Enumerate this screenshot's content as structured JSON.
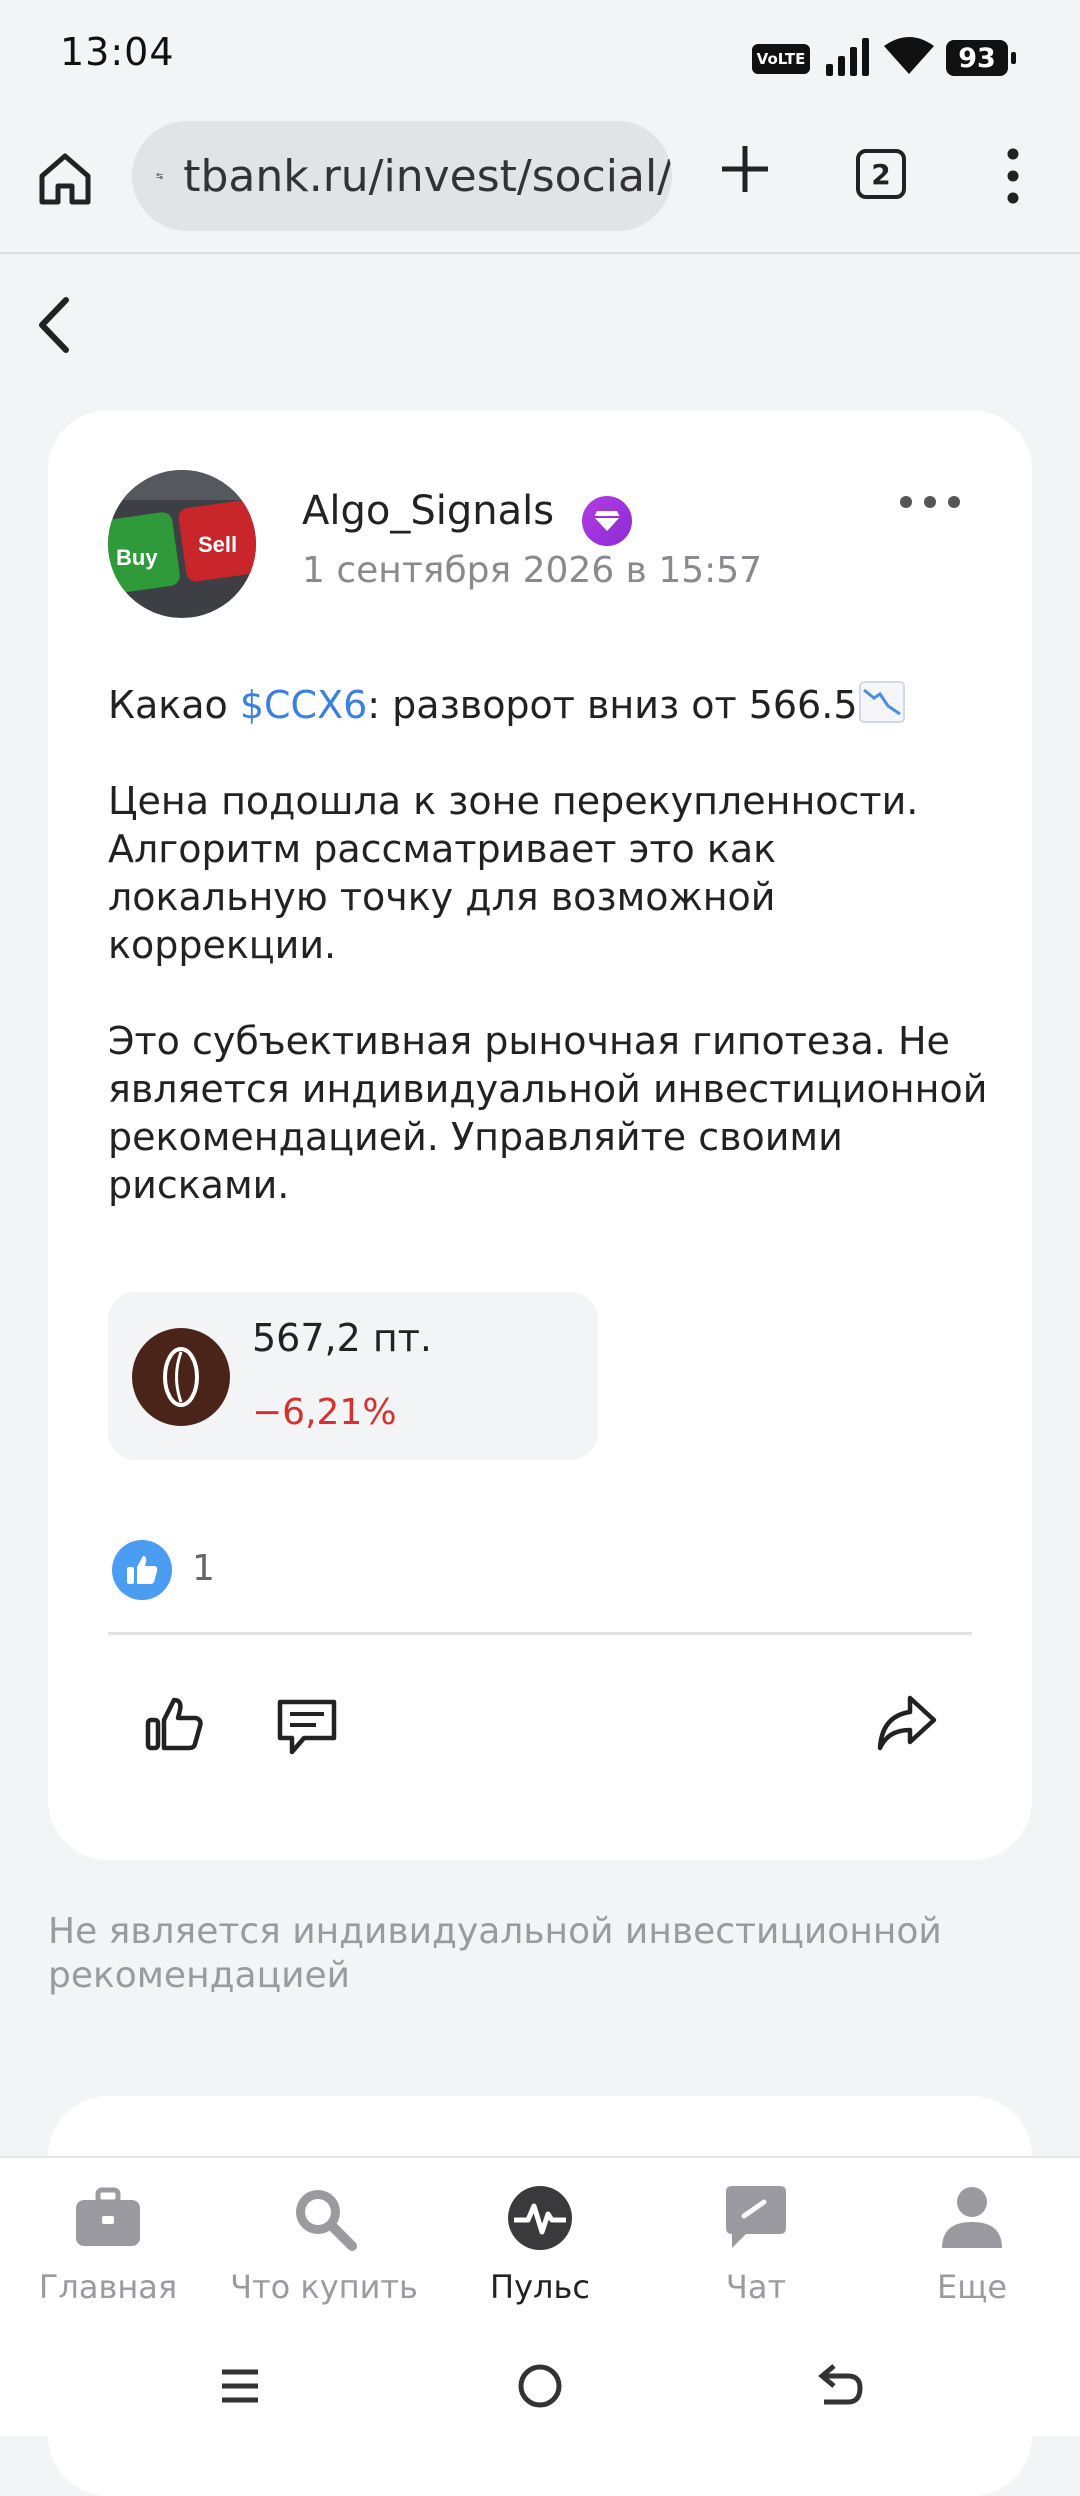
{
  "status_bar": {
    "time": "13:04",
    "volte": "VoLTE",
    "battery": "93"
  },
  "browser": {
    "url": "tbank.ru/invest/social/",
    "tab_count": "2"
  },
  "post": {
    "author": "Algo_Signals",
    "date": "1 сентября 2026 в 15:57",
    "title_prefix": "Какао ",
    "ticker": "$CCX6",
    "title_suffix": ": разворот вниз от 566.5",
    "paragraph1": "Цена подошла к зоне перекупленности. Алгоритм рассматривает это как локальную точку для возможной коррекции.",
    "paragraph2": "Это субъективная рыночная гипотеза. Не является индивидуальной инвестиционной рекомендацией. Управляйте своими рисками.",
    "instrument": {
      "price": "567,2 пт.",
      "change": "−6,21%"
    },
    "likes_count": "1",
    "avatar_keys": {
      "buy": "Buy",
      "sell": "Sell"
    }
  },
  "disclaimer": "Не является индивидуальной инвестиционной рекомендацией",
  "bottom_nav": {
    "items": [
      {
        "label": "Главная",
        "icon": "briefcase-icon"
      },
      {
        "label": "Что купить",
        "icon": "search-icon"
      },
      {
        "label": "Пульс",
        "icon": "pulse-icon"
      },
      {
        "label": "Чат",
        "icon": "chat-icon"
      },
      {
        "label": "Еще",
        "icon": "profile-icon"
      }
    ],
    "active": "Пульс"
  },
  "colors": {
    "ticker_link": "#3b7fe0",
    "negative": "#d8302f",
    "premium": "#9b33dc",
    "like_blue": "#4a9df0"
  }
}
